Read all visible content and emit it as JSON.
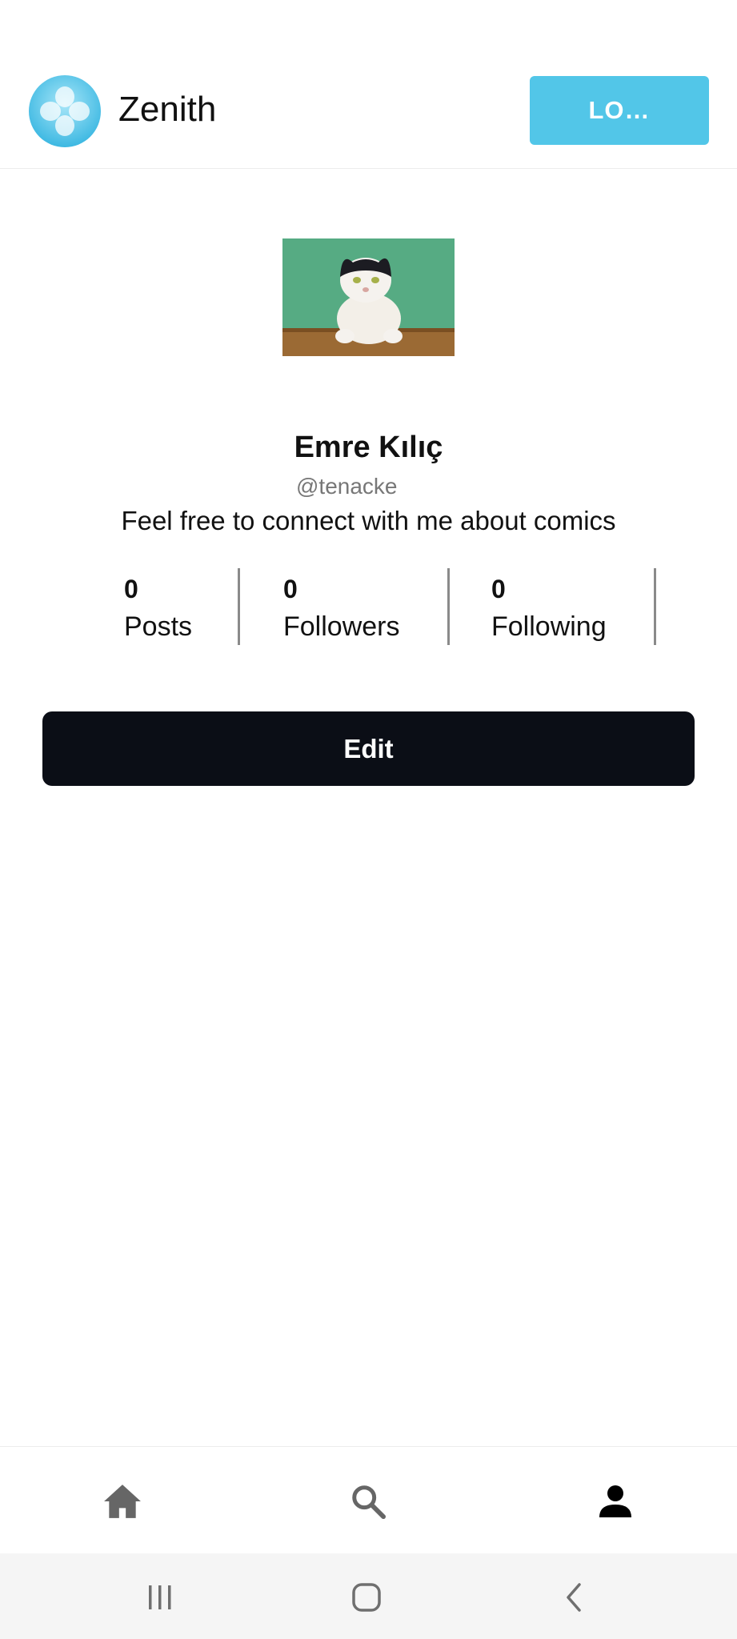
{
  "header": {
    "app_title": "Zenith",
    "login_label": "LO…",
    "logo_icon": "zenith-logo-icon",
    "accent_color": "#52c6e8"
  },
  "profile": {
    "display_name": "Emre Kılıç",
    "handle": "@tenacke",
    "bio": "Feel free to connect with me about comics",
    "photo_icon": "cat-photo"
  },
  "stats": [
    {
      "count": "0",
      "label": "Posts"
    },
    {
      "count": "0",
      "label": "Followers"
    },
    {
      "count": "0",
      "label": "Following"
    }
  ],
  "actions": {
    "edit_label": "Edit",
    "edit_color": "#0b0e16"
  },
  "bottom_nav": {
    "items": [
      {
        "icon": "home-icon",
        "active": false
      },
      {
        "icon": "search-icon",
        "active": false
      },
      {
        "icon": "person-icon",
        "active": true
      }
    ]
  },
  "system_nav": {
    "items": [
      "recent-apps-icon",
      "home-button-icon",
      "back-icon"
    ]
  }
}
